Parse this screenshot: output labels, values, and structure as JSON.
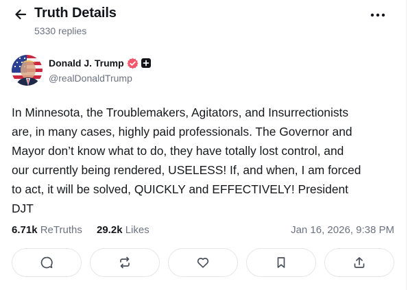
{
  "header": {
    "title": "Truth Details",
    "replies": "5330 replies",
    "back_icon": "arrow-left-icon",
    "more_icon": "more-horizontal-icon"
  },
  "post": {
    "author_name": "Donald J. Trump",
    "handle": "@realDonaldTrump",
    "verified_icon": "verified-badge-icon",
    "plus_icon": "plus-badge-icon",
    "body": "In Minnesota, the Troublemakers, Agitators, and Insurrectionists\nare, in many cases, highly paid professionals. The Governor and\nMayor don’t know what to do, they have totally lost control, and\nour currently being rendered, USELESS! If, and when, I am forced\nto act, it will be solved, QUICKLY and EFFECTIVELY! President\nDJT"
  },
  "stats": {
    "retruths_count": "6.71k",
    "retruths_label": "ReTruths",
    "likes_count": "29.2k",
    "likes_label": "Likes",
    "timestamp": "Jan 16, 2026, 9:38 PM"
  },
  "actions": [
    {
      "name": "reply",
      "icon": "comment-icon"
    },
    {
      "name": "retruth",
      "icon": "retruth-icon"
    },
    {
      "name": "like",
      "icon": "heart-icon"
    },
    {
      "name": "bookmark",
      "icon": "bookmark-icon"
    },
    {
      "name": "share",
      "icon": "share-icon"
    }
  ],
  "colors": {
    "verified": "#f2576b",
    "text_primary": "#14151a",
    "text_secondary": "#6b7280",
    "border": "#e4e6ea"
  }
}
